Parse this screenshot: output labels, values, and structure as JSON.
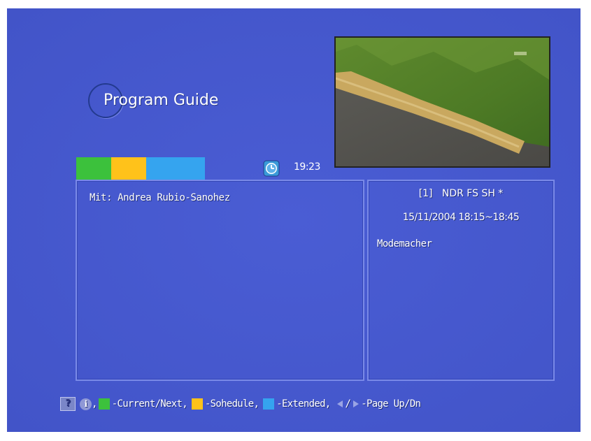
{
  "title": "Program Guide",
  "clock": {
    "icon": "clock-icon",
    "time": "19:23"
  },
  "color_bar": [
    {
      "name": "green",
      "color": "#3cc13c"
    },
    {
      "name": "yellow",
      "color": "#ffc21a"
    },
    {
      "name": "blue",
      "color": "#35a4ef"
    }
  ],
  "description": "Mit: Andrea Rubio-Sanohez",
  "program": {
    "channel": "[1]   NDR FS SH *",
    "datetime": "15/11/2004 18:15~18:45",
    "title": "Modemacher"
  },
  "help_bar": {
    "help_icon_label": "?",
    "info_icon_label": "i",
    "comma1": ",",
    "current_next": "-Current/Next,",
    "schedule": "-Sohedule,",
    "extended": "-Extended,",
    "slash": "/",
    "page": "-Page Up/Dn"
  },
  "colors": {
    "background": "#4558cf",
    "green": "#3cc13c",
    "yellow": "#ffc21a",
    "blue": "#35a4ef"
  }
}
